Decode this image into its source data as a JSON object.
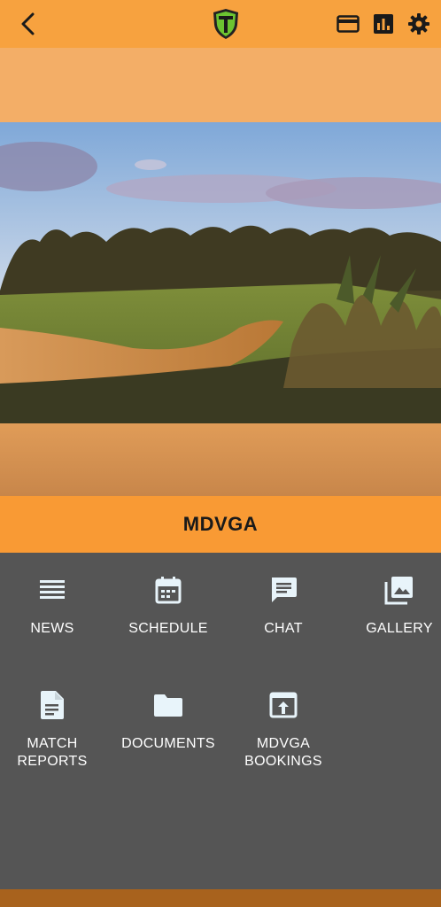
{
  "header": {
    "back_icon": "chevron-left-icon",
    "logo_icon": "team-shield-logo",
    "actions": [
      {
        "icon": "credit-card-icon"
      },
      {
        "icon": "bar-chart-icon"
      },
      {
        "icon": "gear-icon"
      }
    ],
    "background": "#F7A23F"
  },
  "club": {
    "name": "MDVGA"
  },
  "menu": {
    "news": {
      "label": "NEWS",
      "icon": "news-list-icon"
    },
    "schedule": {
      "label": "SCHEDULE",
      "icon": "calendar-icon"
    },
    "chat": {
      "label": "CHAT",
      "icon": "chat-icon"
    },
    "gallery": {
      "label": "GALLERY",
      "icon": "gallery-icon"
    },
    "match_reports": {
      "label": "MATCH\nREPORTS",
      "icon": "document-icon"
    },
    "documents": {
      "label": "DOCUMENTS",
      "icon": "folder-icon"
    },
    "bookings": {
      "label": "MDVGA\nBOOKINGS",
      "icon": "open-in-browser-icon"
    }
  },
  "colors": {
    "accent": "#F99A34",
    "panel": "#555555",
    "icon": "#E8F4FA"
  }
}
